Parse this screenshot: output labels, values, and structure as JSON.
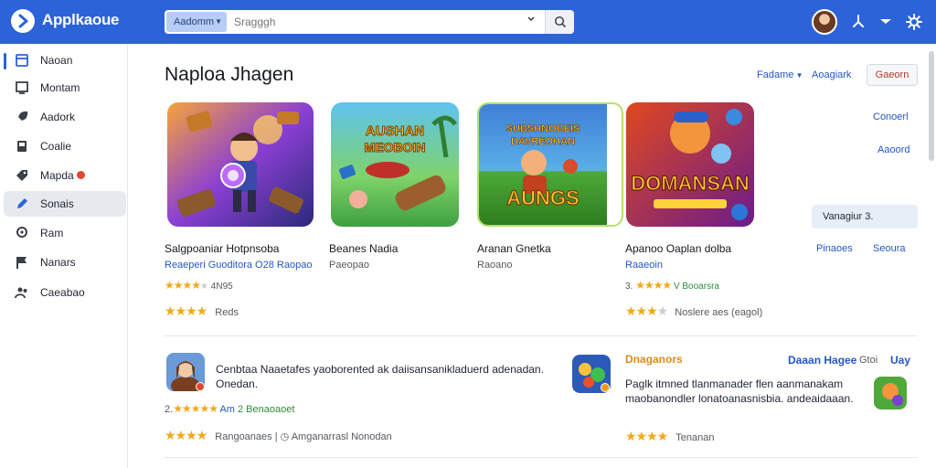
{
  "header": {
    "app_name": "Applkaoue",
    "search_scope": "Aadomm",
    "search_placeholder": "Sragggh",
    "icons": [
      "logo-icon",
      "search-icon",
      "share-icon",
      "download-icon",
      "gear-icon"
    ]
  },
  "sidebar": {
    "items": [
      {
        "label": "Naoan",
        "icon": "store-icon"
      },
      {
        "label": "Montam",
        "icon": "monitor-icon"
      },
      {
        "label": "Aadork",
        "icon": "rocket-icon"
      },
      {
        "label": "Coalie",
        "icon": "device-icon"
      },
      {
        "label": "Mapda",
        "icon": "tag-icon"
      },
      {
        "label": "Sonais",
        "icon": "pencil-icon"
      },
      {
        "label": "Ram",
        "icon": "location-icon"
      },
      {
        "label": "Nanars",
        "icon": "flag-icon"
      },
      {
        "label": "Caeabao",
        "icon": "people-icon"
      }
    ]
  },
  "main": {
    "title": "Naploa Jhagen",
    "links": [
      "Fadame",
      "Aoagiark"
    ],
    "action_button": "Gaeorn",
    "side_links": [
      "Conoerl",
      "Aaoord"
    ],
    "side_box": "Vanagiur 3.",
    "side_bottom_links": [
      "Pinaoes",
      "Seoura"
    ]
  },
  "cards": [
    {
      "title": "Salgpoaniar Hotpnsoba",
      "developer": "Reaeperi Guoditora O28 Raopao",
      "developer_color": "#2457c5",
      "rating_text": "4N95",
      "meta": "Reds",
      "thumb_text": ""
    },
    {
      "title": "Beanes Nadia",
      "developer": "Paeopao",
      "developer_color": "#55595f",
      "rating_text": "",
      "meta": "",
      "thumb_text": "AUSHAN MEOBOIN"
    },
    {
      "title": "Aranan Gnetka",
      "developer": "Raoano",
      "developer_color": "#55595f",
      "rating_text": "",
      "meta": "",
      "thumb_text": "AUNGS"
    },
    {
      "title": "Apanoo Oaplan dolba",
      "developer": "Raaeoin",
      "developer_color": "#2457c5",
      "rating_text": "V Booarsra",
      "rating_prefix": "3.",
      "meta": "Noslere aes (eagol)",
      "thumb_text": "DOMANSAN"
    }
  ],
  "list": [
    {
      "text": "Cenbtaa Naaetafes yaoborented ak daiisansanikladuerd adenadan. Onedan.",
      "rating_prefix": "2.",
      "rating_label": "Am",
      "rating_value": "2 Benaoaoet",
      "footer": "Rangoanaes",
      "footer_detail": "Amganarrasl Nonodan"
    },
    {
      "title": "Dnaganors",
      "extra_a": "Daaan Hagee",
      "extra_b": "Gtoi",
      "extra_c": "Uay",
      "text": "Paglk itmned tlanmanader flen aanmanakam maobanondler lonatoanasnisbia. andeaidaaan.",
      "footer": "Tenanan"
    }
  ],
  "colors": {
    "header_bg": "#2c63d8",
    "link": "#2457c5",
    "star": "#f2a81d",
    "badge": "#e5462e",
    "accent_orange": "#e08a1a"
  }
}
